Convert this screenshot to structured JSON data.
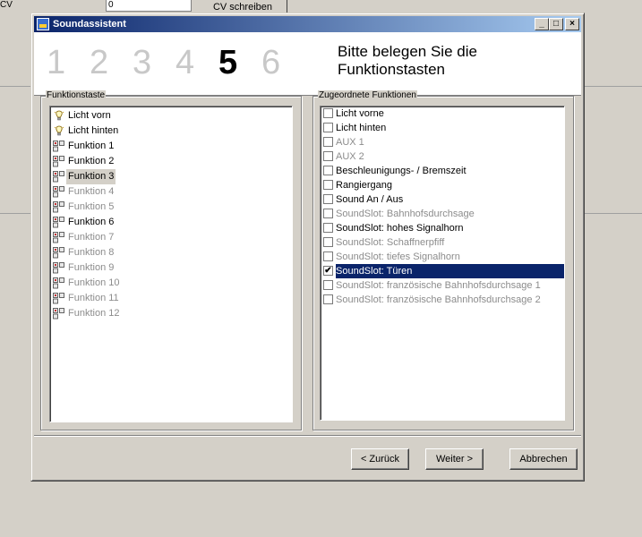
{
  "background": {
    "cv_label": "CV",
    "cv_value": "0",
    "write_button": "CV schreiben"
  },
  "dialog": {
    "title": "Soundassistent",
    "window_buttons": {
      "minimize": "_",
      "maximize": "□",
      "close": "×"
    },
    "steps": [
      "1",
      "2",
      "3",
      "4",
      "5",
      "6"
    ],
    "active_step": "5",
    "header_title_line1": "Bitte belegen Sie die",
    "header_title_line2": "Funktionstasten",
    "left_group_label": "Funktionstaste",
    "right_group_label": "Zugeordnete Funktionen",
    "function_keys": [
      {
        "label": "Licht vorn",
        "icon": "bulb-icon",
        "enabled": true
      },
      {
        "label": "Licht hinten",
        "icon": "bulb-icon",
        "enabled": true
      },
      {
        "label": "Funktion 1",
        "icon": "key-icon",
        "enabled": true
      },
      {
        "label": "Funktion 2",
        "icon": "key-icon",
        "enabled": true
      },
      {
        "label": "Funktion 3",
        "icon": "key-icon",
        "enabled": true,
        "selected": true
      },
      {
        "label": "Funktion 4",
        "icon": "key-icon",
        "enabled": false
      },
      {
        "label": "Funktion 5",
        "icon": "key-icon",
        "enabled": false
      },
      {
        "label": "Funktion 6",
        "icon": "key-icon",
        "enabled": true
      },
      {
        "label": "Funktion 7",
        "icon": "key-icon",
        "enabled": false
      },
      {
        "label": "Funktion 8",
        "icon": "key-icon",
        "enabled": false
      },
      {
        "label": "Funktion 9",
        "icon": "key-icon",
        "enabled": false
      },
      {
        "label": "Funktion 10",
        "icon": "key-icon",
        "enabled": false
      },
      {
        "label": "Funktion 11",
        "icon": "key-icon",
        "enabled": false
      },
      {
        "label": "Funktion 12",
        "icon": "key-icon",
        "enabled": false
      }
    ],
    "assigned_functions": [
      {
        "label": "Licht vorne",
        "checked": false,
        "enabled": true
      },
      {
        "label": "Licht hinten",
        "checked": false,
        "enabled": true
      },
      {
        "label": "AUX 1",
        "checked": false,
        "enabled": false
      },
      {
        "label": "AUX 2",
        "checked": false,
        "enabled": false
      },
      {
        "label": "Beschleunigungs- / Bremszeit",
        "checked": false,
        "enabled": true
      },
      {
        "label": "Rangiergang",
        "checked": false,
        "enabled": true
      },
      {
        "label": "Sound An / Aus",
        "checked": false,
        "enabled": true
      },
      {
        "label": "SoundSlot: Bahnhofsdurchsage",
        "checked": false,
        "enabled": false
      },
      {
        "label": "SoundSlot: hohes Signalhorn",
        "checked": false,
        "enabled": true
      },
      {
        "label": "SoundSlot: Schaffnerpfiff",
        "checked": false,
        "enabled": false
      },
      {
        "label": "SoundSlot: tiefes Signalhorn",
        "checked": false,
        "enabled": false
      },
      {
        "label": "SoundSlot: Türen",
        "checked": true,
        "enabled": true,
        "selected": true
      },
      {
        "label": "SoundSlot: französische Bahnhofsdurchsage 1",
        "checked": false,
        "enabled": false
      },
      {
        "label": "SoundSlot: französische Bahnhofsdurchsage 2",
        "checked": false,
        "enabled": false
      }
    ],
    "buttons": {
      "back": "< Zurück",
      "next": "Weiter >",
      "cancel": "Abbrechen"
    },
    "colors": {
      "titlebar_start": "#0a246a",
      "titlebar_end": "#a6caf0",
      "selection": "#0a246a",
      "face": "#d4d0c8",
      "disabled_text": "#8c8c8c"
    }
  }
}
